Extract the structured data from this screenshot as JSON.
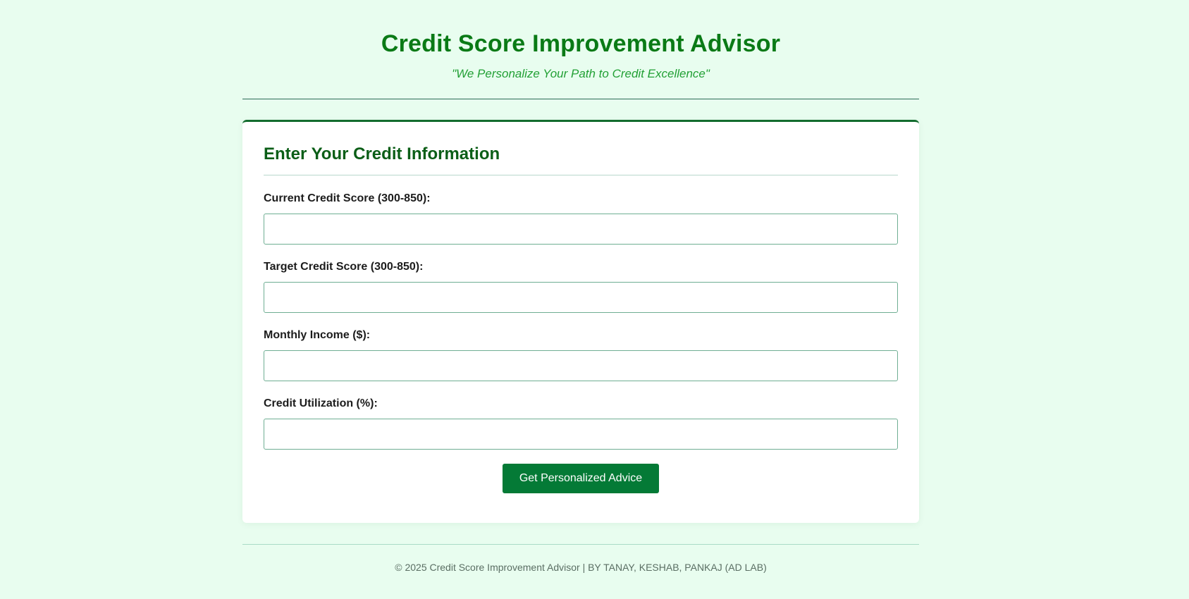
{
  "header": {
    "title": "Credit Score Improvement Advisor",
    "tagline": "\"We Personalize Your Path to Credit Excellence\""
  },
  "form": {
    "heading": "Enter Your Credit Information",
    "fields": [
      {
        "label": "Current Credit Score (300-850):",
        "value": "",
        "placeholder": ""
      },
      {
        "label": "Target Credit Score (300-850):",
        "value": "",
        "placeholder": ""
      },
      {
        "label": "Monthly Income ($):",
        "value": "",
        "placeholder": ""
      },
      {
        "label": "Credit Utilization (%):",
        "value": "",
        "placeholder": ""
      }
    ],
    "submit_label": "Get Personalized Advice"
  },
  "footer": {
    "text": "© 2025 Credit Score Improvement Advisor | BY TANAY, KESHAB, PANKAJ (AD LAB)"
  },
  "colors": {
    "background": "#e8fdef",
    "title": "#0a7a16",
    "tagline": "#22a035",
    "card_heading": "#0b5e17",
    "button": "#047a36",
    "input_border": "#6fae93"
  }
}
